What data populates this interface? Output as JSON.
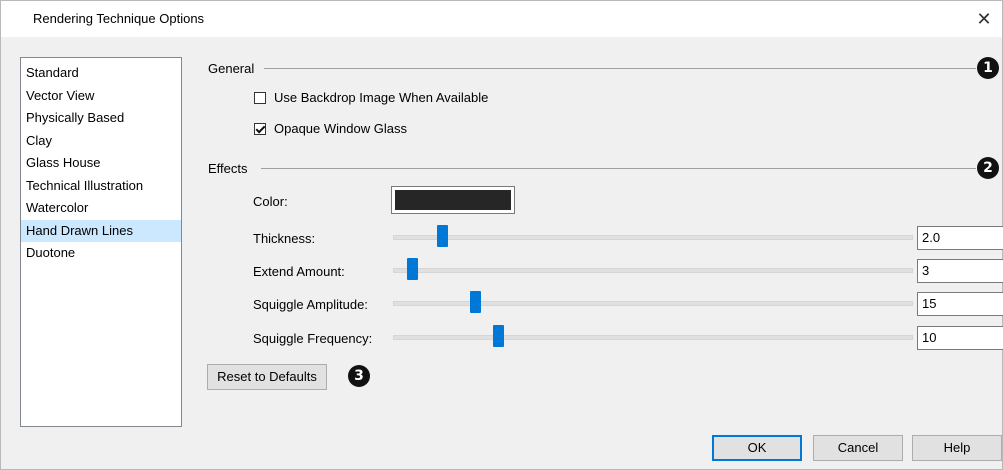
{
  "window": {
    "title": "Rendering Technique Options",
    "close_glyph": "✕"
  },
  "techniques": {
    "items": [
      "Standard",
      "Vector View",
      "Physically Based",
      "Clay",
      "Glass House",
      "Technical Illustration",
      "Watercolor",
      "Hand Drawn Lines",
      "Duotone"
    ],
    "selected_index": 7
  },
  "general": {
    "label": "General",
    "callout": "1",
    "use_backdrop": {
      "label": "Use Backdrop Image When Available",
      "checked": false
    },
    "opaque_glass": {
      "label": "Opaque Window Glass",
      "checked": true
    }
  },
  "effects": {
    "label": "Effects",
    "callout": "2",
    "color": {
      "label": "Color:",
      "value": "#262626"
    },
    "thickness": {
      "label": "Thickness:",
      "value": "2.0"
    },
    "extend_amount": {
      "label": "Extend Amount:",
      "value": "3"
    },
    "squiggle_amplitude": {
      "label": "Squiggle Amplitude:",
      "value": "15"
    },
    "squiggle_frequency": {
      "label": "Squiggle Frequency:",
      "value": "10"
    }
  },
  "reset": {
    "label": "Reset to Defaults",
    "callout": "3"
  },
  "footer": {
    "ok": "OK",
    "cancel": "Cancel",
    "help": "Help"
  },
  "colors": {
    "accent": "#0078d7",
    "selection": "#cce8ff"
  }
}
